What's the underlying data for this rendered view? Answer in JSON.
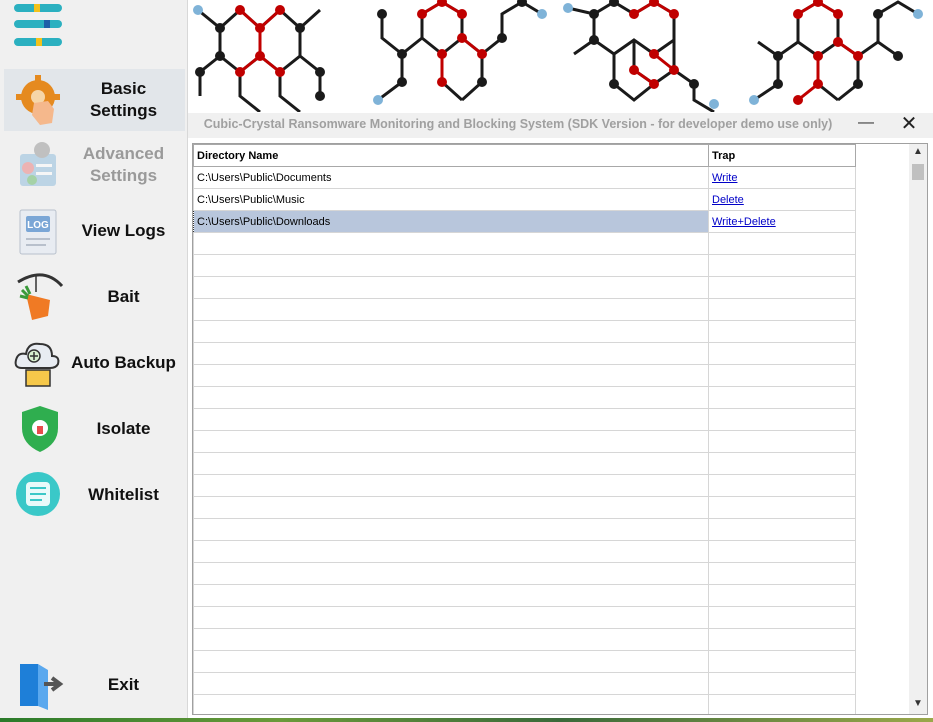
{
  "app": {
    "title": "Cubic-Crystal Ransomware Monitoring and Blocking System (SDK Version - for developer demo use only)",
    "minimize_glyph": "—",
    "close_glyph": "✕"
  },
  "sidebar": {
    "menu_icon": "hamburger-menu-icon",
    "items": [
      {
        "label": "Basic\nSettings",
        "icon": "gear-hand-icon",
        "state": "active"
      },
      {
        "label": "Advanced\nSettings",
        "icon": "advanced-settings-icon",
        "state": "disabled"
      },
      {
        "label": "View Logs",
        "icon": "log-document-icon",
        "state": "normal"
      },
      {
        "label": "Bait",
        "icon": "carrot-bait-icon",
        "state": "normal"
      },
      {
        "label": "Auto Backup",
        "icon": "cloud-backup-icon",
        "state": "normal"
      },
      {
        "label": "Isolate",
        "icon": "shield-lock-icon",
        "state": "normal"
      },
      {
        "label": "Whitelist",
        "icon": "checklist-icon",
        "state": "normal"
      },
      {
        "label": "Exit",
        "icon": "exit-door-icon",
        "state": "normal"
      }
    ]
  },
  "table": {
    "columns": [
      "Directory Name",
      "Trap"
    ],
    "rows": [
      {
        "directory": "C:\\Users\\Public\\Documents",
        "trap": "Write"
      },
      {
        "directory": "C:\\Users\\Public\\Music",
        "trap": "Delete"
      },
      {
        "directory": "C:\\Users\\Public\\Downloads",
        "trap": "Write+Delete"
      }
    ],
    "selected_row": 2
  },
  "colors": {
    "accent_selected": "#b8c6dc",
    "link": "#0000c8",
    "molecule_red": "#c00000",
    "molecule_black": "#1a1a1a"
  }
}
